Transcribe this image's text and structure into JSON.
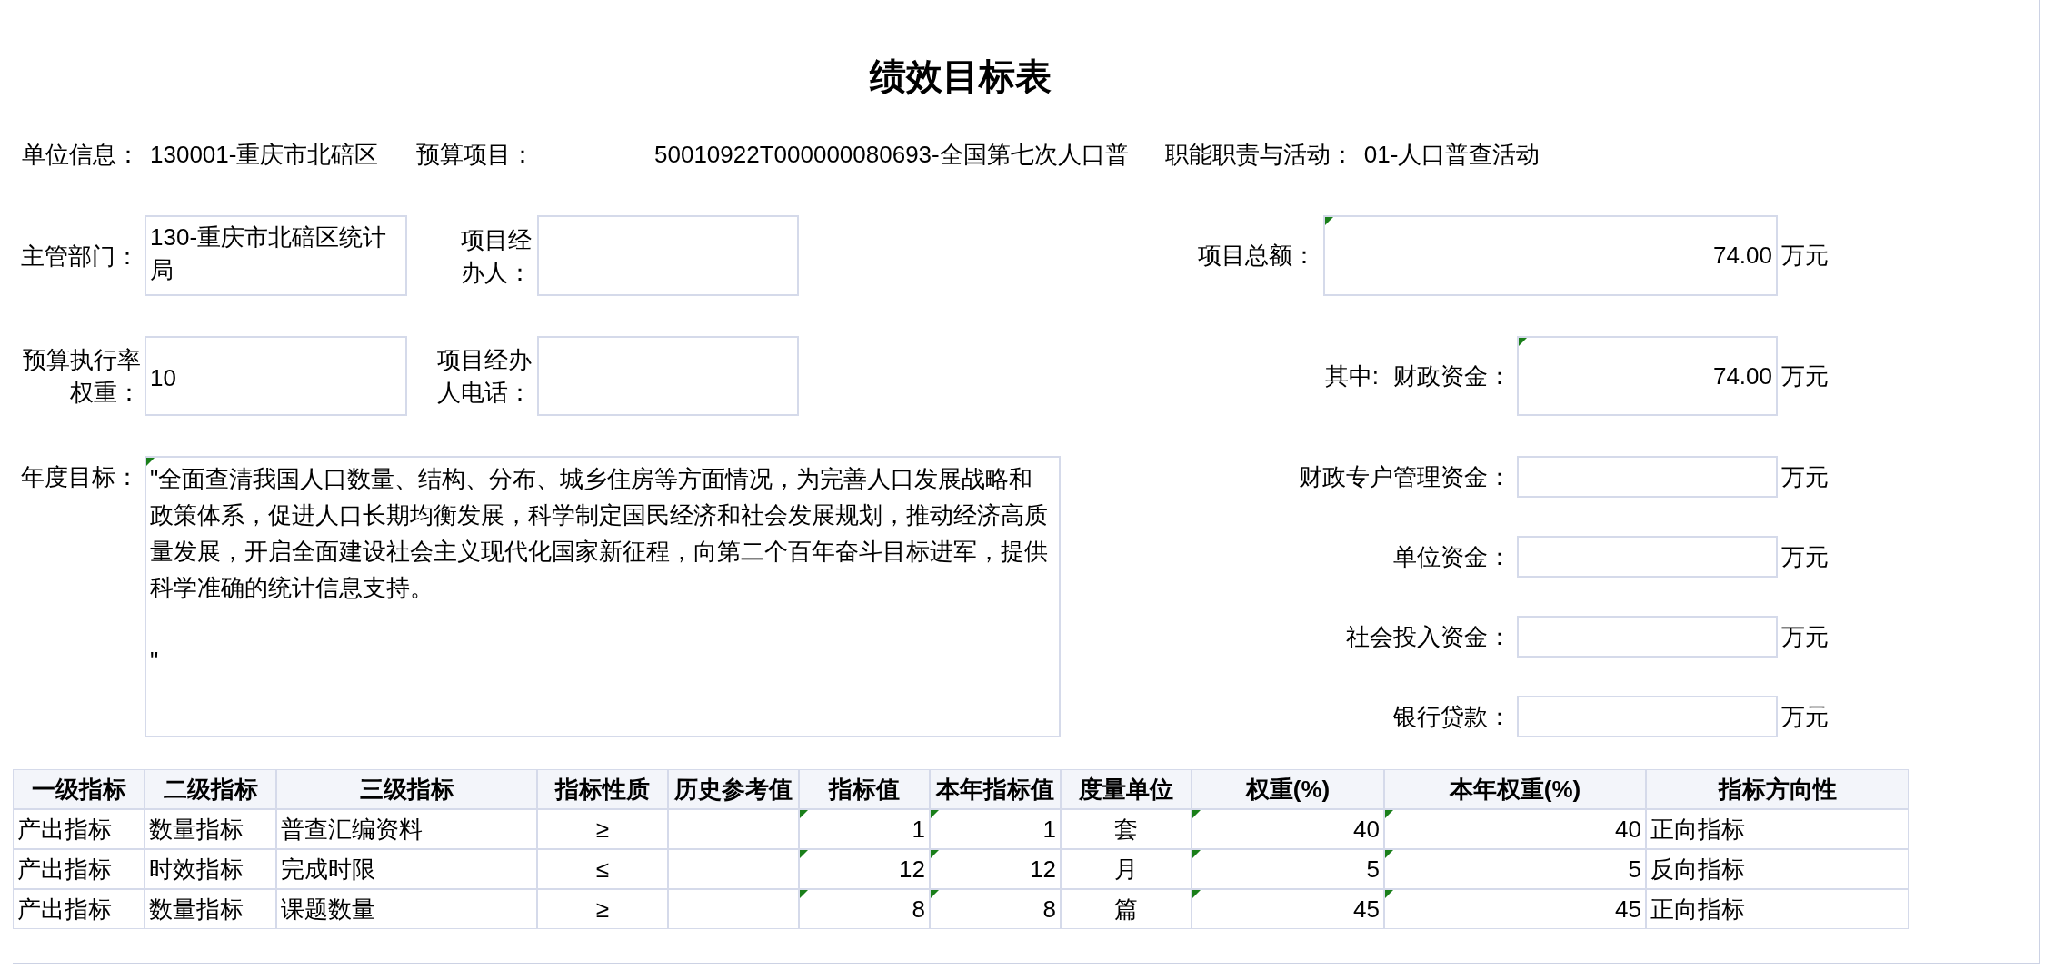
{
  "title": "绩效目标表",
  "info": [
    {
      "label": "单位信息：",
      "value": "130001-重庆市北碚区"
    },
    {
      "label": "预算项目：",
      "value": "50010922T000000080693-全国第七次人口普"
    },
    {
      "label": "职能职责与活动：",
      "value": "01-人口普查活动"
    }
  ],
  "left_fields": [
    {
      "label": "主管部门：",
      "value": "130-重庆市北碚区统计局",
      "flagged": false
    },
    {
      "label": "项目经办人：",
      "flagged": false
    },
    {
      "label": "预算执行率权重：",
      "value": "10",
      "flagged": false
    },
    {
      "label": "项目经办人电话：",
      "flagged": false
    }
  ],
  "annual_goal": {
    "label": "年度目标：",
    "value": "\"全面查清我国人口数量、结构、分布、城乡住房等方面情况，为完善人口发展战略和政策体系，促进人口长期均衡发展，科学制定国民经济和社会发展规划，推动经济高质量发展，开启全面建设社会主义现代化国家新征程，向第二个百年奋斗目标进军，提供科学准确的统计信息支持。\n\n\"",
    "flagged": true
  },
  "funding": {
    "total": {
      "label": "项目总额：",
      "value": "74.00",
      "unit": "万元",
      "flagged": true
    },
    "of_which": "其中:",
    "sources": [
      {
        "label": "财政资金：",
        "value": "74.00",
        "unit": "万元",
        "flagged": true
      },
      {
        "label": "财政专户管理资金：",
        "unit": "万元",
        "flagged": false
      },
      {
        "label": "单位资金：",
        "unit": "万元",
        "flagged": false
      },
      {
        "label": "社会投入资金：",
        "unit": "万元",
        "flagged": false
      },
      {
        "label": "银行贷款：",
        "unit": "万元",
        "flagged": false
      }
    ]
  },
  "table": {
    "columns": [
      {
        "label": "一级指标",
        "kind": "text",
        "flagged": false
      },
      {
        "label": "二级指标",
        "kind": "text",
        "flagged": false
      },
      {
        "label": "三级指标",
        "kind": "text",
        "flagged": false
      },
      {
        "label": "指标性质",
        "kind": "symbol",
        "flagged": false
      },
      {
        "label": "历史参考值",
        "kind": "number",
        "flagged": false
      },
      {
        "label": "指标值",
        "kind": "number",
        "flagged": true
      },
      {
        "label": "本年指标值",
        "kind": "number",
        "flagged": true
      },
      {
        "label": "度量单位",
        "kind": "symbol",
        "flagged": false
      },
      {
        "label": "权重(%)",
        "kind": "number",
        "flagged": true
      },
      {
        "label": "本年权重(%)",
        "kind": "number",
        "flagged": true
      },
      {
        "label": "指标方向性",
        "kind": "text",
        "flagged": false
      }
    ],
    "rows": [
      {
        "level_1": "产出指标",
        "level_2": "数量指标",
        "level_3": "普查汇编资料",
        "nature": "≥",
        "target": "1",
        "this_year_target": "1",
        "unit": "套",
        "weight": "40",
        "this_year_weight": "40",
        "direction": "正向指标"
      },
      {
        "level_1": "产出指标",
        "level_2": "时效指标",
        "level_3": "完成时限",
        "nature": "≤",
        "target": "12",
        "this_year_target": "12",
        "unit": "月",
        "weight": "5",
        "this_year_weight": "5",
        "direction": "反向指标"
      },
      {
        "level_1": "产出指标",
        "level_2": "数量指标",
        "level_3": "课题数量",
        "nature": "≥",
        "target": "8",
        "this_year_target": "8",
        "unit": "篇",
        "weight": "45",
        "this_year_weight": "45",
        "direction": "正向指标"
      }
    ]
  }
}
